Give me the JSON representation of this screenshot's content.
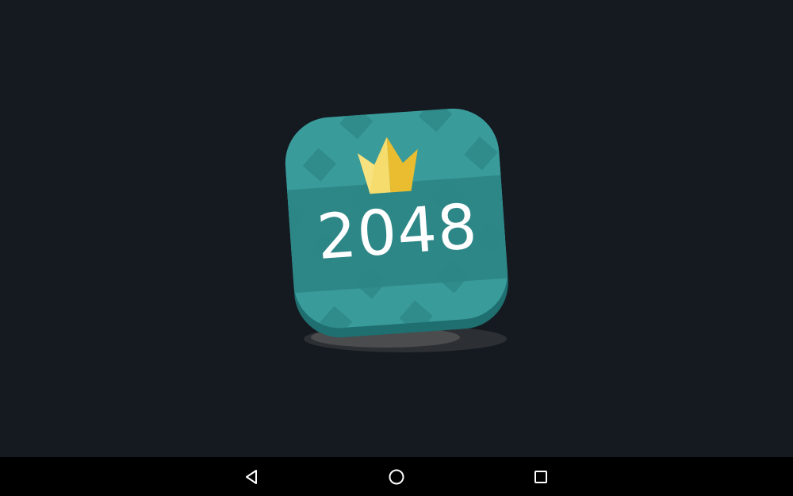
{
  "splash": {
    "logo_text": "2048",
    "background_color": "#151a21",
    "tile_color": "#3a9b9b",
    "crown_color": "#f0c93d"
  },
  "navbar": {
    "back_icon": "back-triangle-icon",
    "home_icon": "home-circle-icon",
    "recents_icon": "recents-square-icon"
  }
}
